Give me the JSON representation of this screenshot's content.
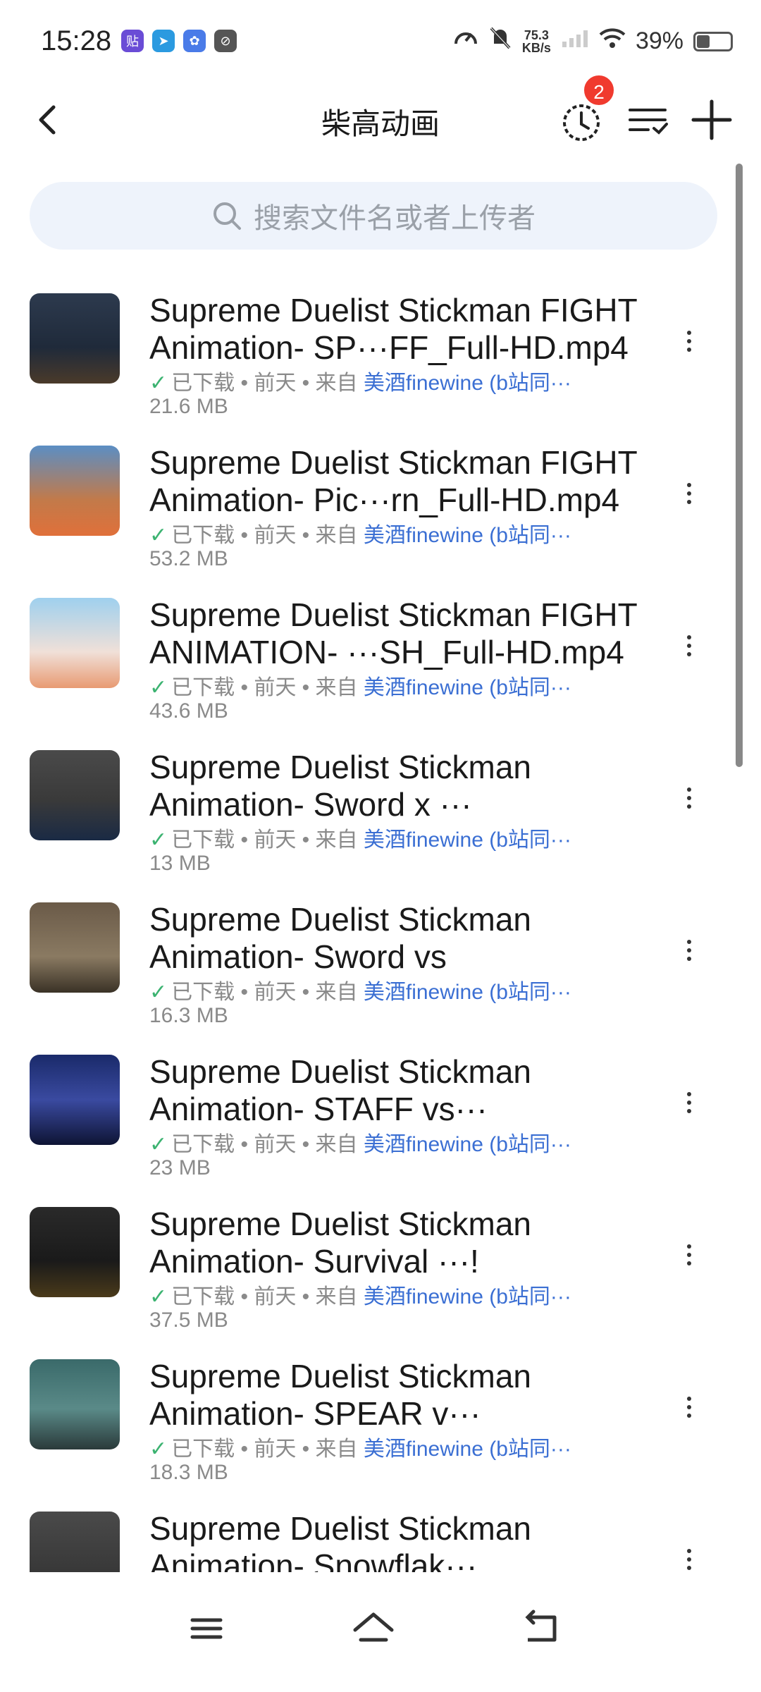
{
  "status": {
    "time": "15:28",
    "net_speed_value": "75.3",
    "net_speed_unit": "KB/s",
    "battery": "39%",
    "battery_level": 0.39
  },
  "header": {
    "title": "柴高动画",
    "history_badge": "2"
  },
  "search": {
    "placeholder": "搜索文件名或者上传者"
  },
  "files": [
    {
      "name": "Supreme Duelist Stickman FIGHT Animation- SP···FF_Full-HD.mp4",
      "status": "已下载",
      "time": "前天",
      "from": "来自",
      "uploader": "美酒finewine (b站同···",
      "size": "21.6 MB"
    },
    {
      "name": "Supreme Duelist Stickman FIGHT Animation- Pic···rn_Full-HD.mp4",
      "status": "已下载",
      "time": "前天",
      "from": "来自",
      "uploader": "美酒finewine (b站同···",
      "size": "53.2 MB"
    },
    {
      "name": "Supreme Duelist Stickman FIGHT ANIMATION- ···SH_Full-HD.mp4",
      "status": "已下载",
      "time": "前天",
      "from": "来自",
      "uploader": "美酒finewine (b站同···",
      "size": "43.6 MB"
    },
    {
      "name": "Supreme Duelist Stickman Animation- Sword x ···",
      "status": "已下载",
      "time": "前天",
      "from": "来自",
      "uploader": "美酒finewine (b站同···",
      "size": "13 MB"
    },
    {
      "name": "Supreme Duelist Stickman Animation- Sword vs",
      "status": "已下载",
      "time": "前天",
      "from": "来自",
      "uploader": "美酒finewine (b站同···",
      "size": "16.3 MB"
    },
    {
      "name": "Supreme Duelist Stickman Animation- STAFF vs···",
      "status": "已下载",
      "time": "前天",
      "from": "来自",
      "uploader": "美酒finewine (b站同···",
      "size": "23 MB"
    },
    {
      "name": "Supreme Duelist Stickman Animation- Survival ···!",
      "status": "已下载",
      "time": "前天",
      "from": "来自",
      "uploader": "美酒finewine (b站同···",
      "size": "37.5 MB"
    },
    {
      "name": "Supreme Duelist Stickman Animation- SPEAR v···",
      "status": "已下载",
      "time": "前天",
      "from": "来自",
      "uploader": "美酒finewine (b站同···",
      "size": "18.3 MB"
    },
    {
      "name": "Supreme Duelist Stickman Animation- Snowflak···",
      "status": "",
      "time": "",
      "from": "",
      "uploader": "",
      "size": ""
    }
  ],
  "colors": {
    "accent_link": "#3b6fd3",
    "check_green": "#3cb371",
    "badge_red": "#f03a2e",
    "search_bg": "#eef3fb"
  }
}
